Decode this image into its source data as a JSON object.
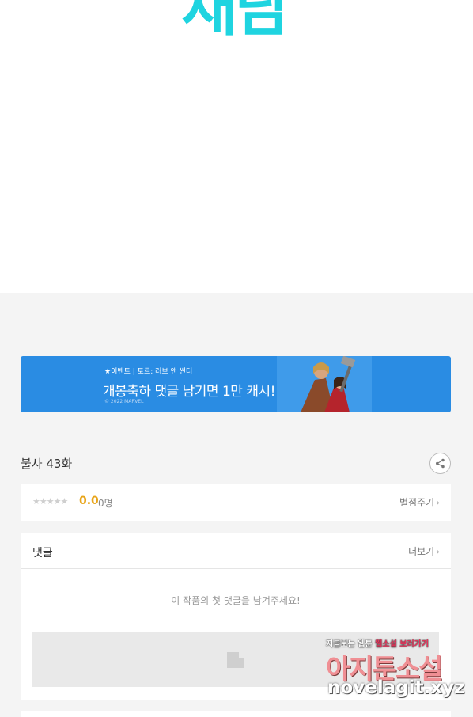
{
  "logo": {
    "text": "채담"
  },
  "banner": {
    "tag": "★이벤트 | 토르: 러브 앤 썬더",
    "headline": "개봉축하 댓글 남기면 1만 캐시!",
    "copyright": "© 2022 MARVEL"
  },
  "episode": {
    "title": "불사 43화",
    "share_icon": "share-icon"
  },
  "rating": {
    "stars": "★★★★★",
    "score": "0.0",
    "count": "0명",
    "rate_link": "별점주기",
    "chevron": "›"
  },
  "comments": {
    "title": "댓글",
    "more_link": "더보기",
    "chevron": "›",
    "empty_message": "이 작품의 첫 댓글을 남겨주세요!"
  },
  "watermark": {
    "line1_a": "지금보는 웹툰",
    "line1_b": "웹소설",
    "line1_c": "보러가기",
    "line2": "아지툰소설",
    "line3": "novelagit.xyz"
  },
  "colors": {
    "accent_logo": "#1fd4e0",
    "banner_blue": "#2a8ce3",
    "score_orange": "#e8a51a"
  }
}
